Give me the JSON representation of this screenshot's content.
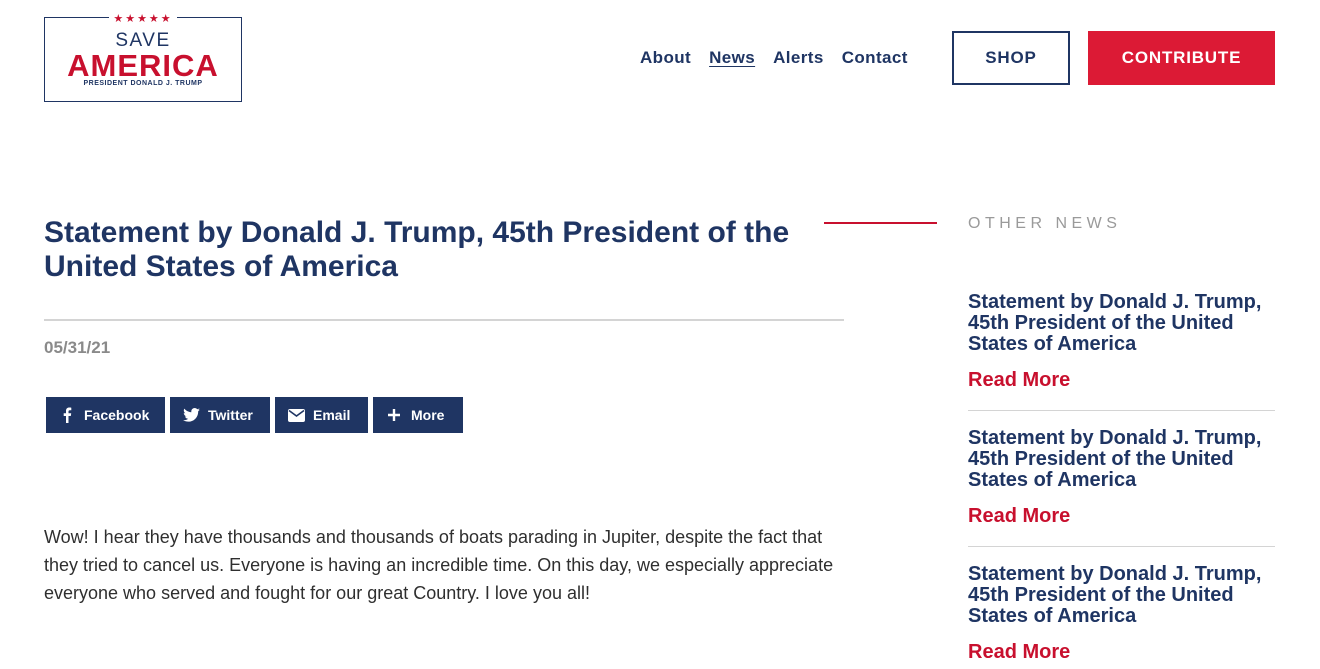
{
  "logo": {
    "stars": "★★★★★",
    "line1": "SAVE",
    "line2": "AMERICA",
    "line3": "PRESIDENT DONALD J. TRUMP"
  },
  "nav": {
    "items": [
      "About",
      "News",
      "Alerts",
      "Contact"
    ],
    "active": "News",
    "shop_label": "SHOP",
    "contribute_label": "CONTRIBUTE"
  },
  "article": {
    "title": "Statement by Donald J. Trump, 45th President of the United States of America",
    "date": "05/31/21",
    "share": {
      "facebook": "Facebook",
      "twitter": "Twitter",
      "email": "Email",
      "more": "More"
    },
    "body": "Wow! I hear they have thousands and thousands of boats parading in Jupiter, despite the fact that they tried to cancel us. Everyone is having an incredible time. On this day, we especially appreciate everyone who served and fought for our great Country.  I love you all!"
  },
  "sidebar": {
    "heading": "OTHER NEWS",
    "items": [
      {
        "title": "Statement by Donald J. Trump, 45th President of the United States of America",
        "link": "Read More"
      },
      {
        "title": "Statement by Donald J. Trump, 45th President of the United States of America",
        "link": "Read More"
      },
      {
        "title": "Statement by Donald J. Trump, 45th President of the United States of America",
        "link": "Read More"
      }
    ]
  },
  "colors": {
    "navy": "#1f3563",
    "red": "#dc1a35",
    "gray_text": "#8a8a8a"
  },
  "icons": [
    "facebook-icon",
    "twitter-icon",
    "email-icon",
    "plus-icon"
  ]
}
